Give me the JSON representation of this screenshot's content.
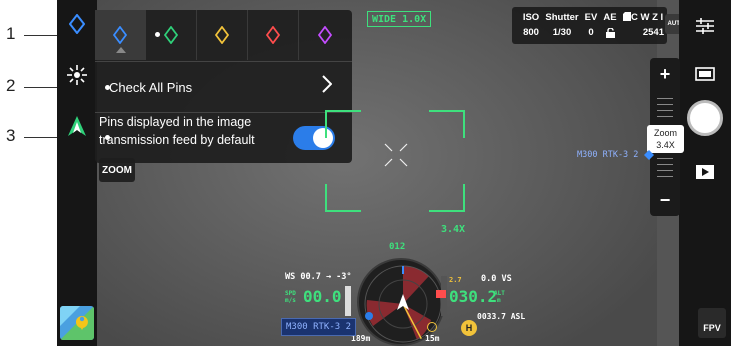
{
  "callouts": [
    "1",
    "2",
    "3"
  ],
  "pin_colors": [
    "#3a8dff",
    "#2fd17a",
    "#f2c33a",
    "#ff4d4d",
    "#c44dff"
  ],
  "pin_panel": {
    "check_all_label": "Check All Pins",
    "pins_default_label": "Pins displayed in the image transmission feed by default",
    "toggle_on": true
  },
  "left_bar": {
    "zoom_label": "ZOOM"
  },
  "camera": {
    "lens_badge": "WIDE 1.0X",
    "iso_label": "ISO",
    "iso_value": "800",
    "shutter_label": "Shutter",
    "shutter_value": "1/30",
    "ev_label": "EV",
    "ev_value": "0",
    "ae_label": "AE",
    "storage_label": "C W Z I",
    "storage_value": "2541",
    "auto_label": "AUTO"
  },
  "zoom": {
    "plus": "+",
    "minus": "−",
    "popup_label": "Zoom",
    "popup_value": "3.4X",
    "frame_label": "3.4X"
  },
  "target_label": "M300 RTK-3 2",
  "hud": {
    "heading": "012",
    "ws": "WS 00.7 → -3°",
    "speed_unit_top": "SPD",
    "speed_unit_bottom": "m/s",
    "speed": "00.0",
    "vs_left": "2.7",
    "vs": "0.0 VS",
    "alt": "030.2",
    "alt_unit_top": "ALT",
    "alt_unit_bottom": "m",
    "asl": "0033.7 ASL",
    "dist_left": "189m",
    "dist_right": "15m",
    "rtk_tag": "M300 RTK-3 2"
  },
  "fpv_label": "FPV"
}
